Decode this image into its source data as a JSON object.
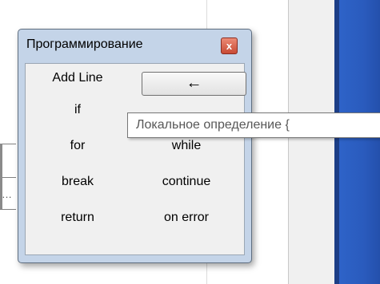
{
  "window": {
    "title": "Программирование",
    "close_glyph": "x"
  },
  "keywords": {
    "add_line": "Add Line",
    "arrow": "←",
    "if": "if",
    "for": "for",
    "while": "while",
    "break": "break",
    "continue": "continue",
    "return": "return",
    "on_error": "on error"
  },
  "tooltip": {
    "text": "Локальное определение {"
  },
  "background": {
    "truncation": "…"
  }
}
